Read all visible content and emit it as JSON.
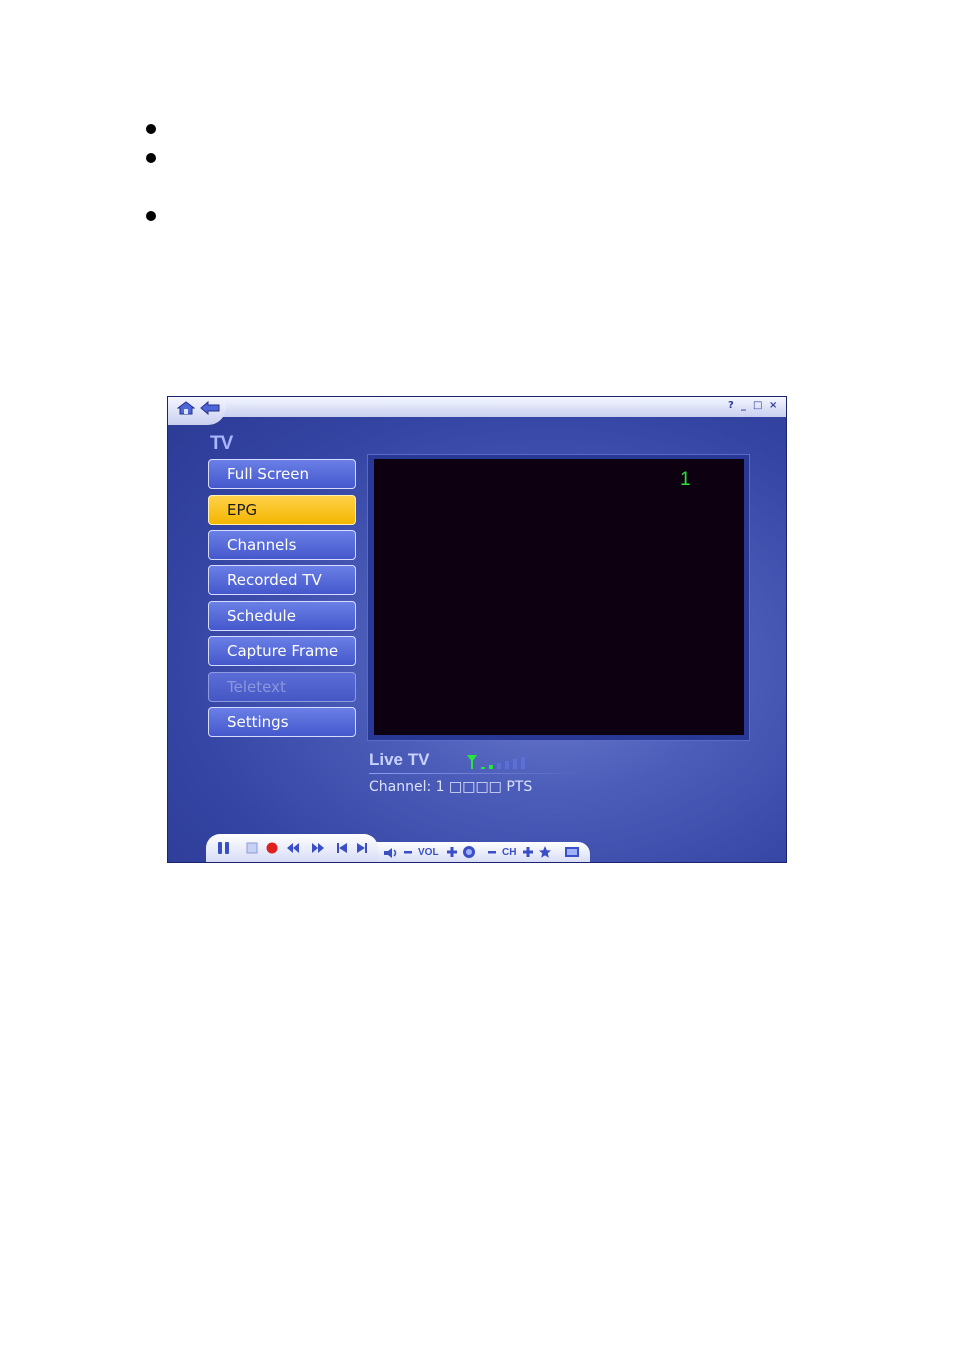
{
  "app": {
    "section_title": "TV",
    "menu": [
      {
        "label": "Full Screen",
        "state": "normal"
      },
      {
        "label": "EPG",
        "state": "selected"
      },
      {
        "label": "Channels",
        "state": "normal"
      },
      {
        "label": "Recorded TV",
        "state": "normal"
      },
      {
        "label": "Schedule",
        "state": "normal"
      },
      {
        "label": "Capture Frame",
        "state": "normal"
      },
      {
        "label": "Teletext",
        "state": "disabled"
      },
      {
        "label": "Settings",
        "state": "normal"
      }
    ],
    "video": {
      "channel_osd": "1"
    },
    "status": {
      "title": "Live TV",
      "channel_line": "Channel: 1 □□□□ PTS"
    },
    "controls": {
      "vol_label": "VOL",
      "ch_label": "CH"
    },
    "colors": {
      "accent_selected": "#ffc21a",
      "button_blue": "#5569d8",
      "osd_green": "#27e63a"
    }
  }
}
